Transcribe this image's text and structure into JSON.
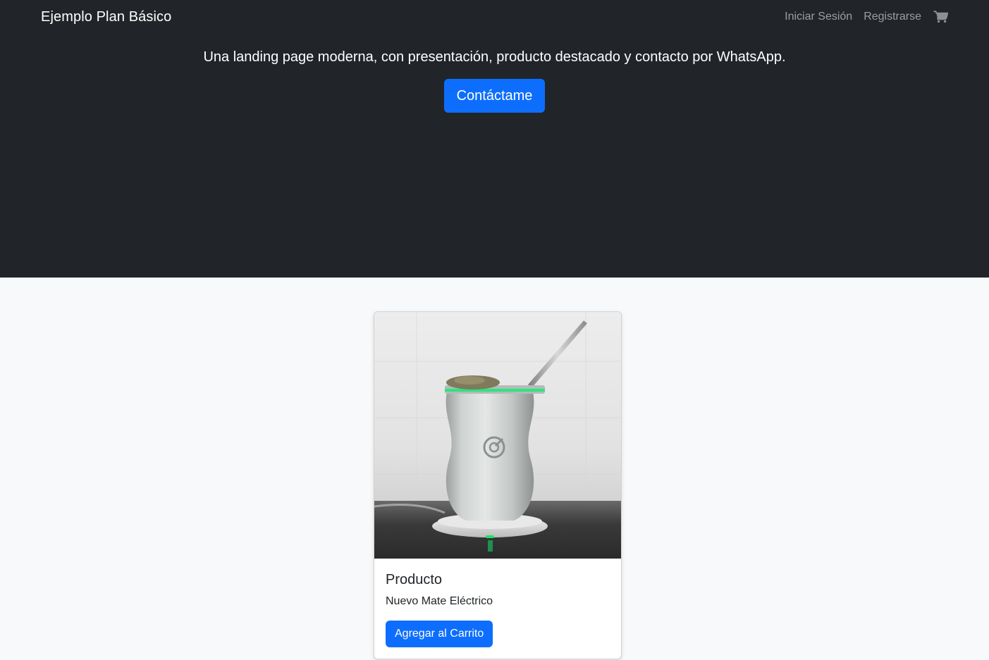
{
  "navbar": {
    "brand": "Ejemplo Plan Básico",
    "links": [
      {
        "label": "Iniciar Sesión"
      },
      {
        "label": "Registrarse"
      }
    ],
    "cart_icon": "shopping-cart-icon"
  },
  "hero": {
    "lead": "Una landing page moderna, con presentación, producto destacado y contacto por WhatsApp.",
    "button_label": "Contáctame"
  },
  "product": {
    "title": "Producto",
    "description": "Nuevo Mate Eléctrico",
    "button_label": "Agregar al Carrito",
    "image": "electric-mate-photo"
  },
  "colors": {
    "dark": "#212529",
    "primary": "#0d6efd",
    "light": "#f8f9fa",
    "accent_green": "#29e07a"
  }
}
